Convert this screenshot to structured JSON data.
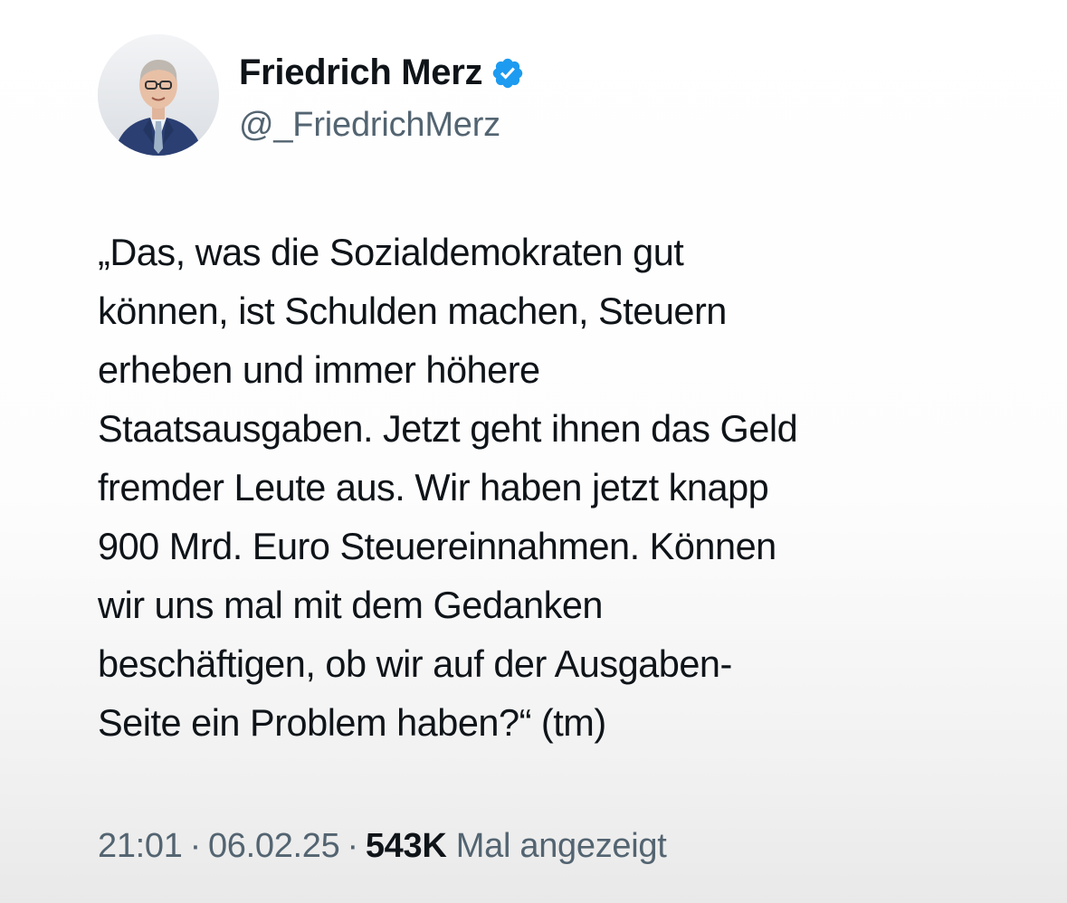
{
  "author": {
    "display_name": "Friedrich Merz",
    "handle": "@_FriedrichMerz",
    "verified_icon": "verified-badge-icon",
    "verified_color": "#1d9bf0"
  },
  "tweet": {
    "lines": [
      "„Das, was die Sozialdemokraten gut",
      "können, ist Schulden machen, Steuern",
      "erheben und immer höhere",
      "Staatsausgaben. Jetzt geht ihnen das Geld",
      "fremder Leute aus. Wir haben jetzt knapp",
      "900 Mrd. Euro Steuereinnahmen. Können",
      "wir uns mal mit dem Gedanken",
      "beschäftigen, ob wir auf der Ausgaben-",
      "Seite ein Problem haben?“ (tm)"
    ]
  },
  "meta": {
    "time": "21:01",
    "separator": "·",
    "date": "06.02.25",
    "views_count": "543K",
    "views_label": "Mal angezeigt"
  },
  "colors": {
    "text_primary": "#0f1419",
    "text_secondary": "#536471",
    "accent": "#1d9bf0"
  }
}
